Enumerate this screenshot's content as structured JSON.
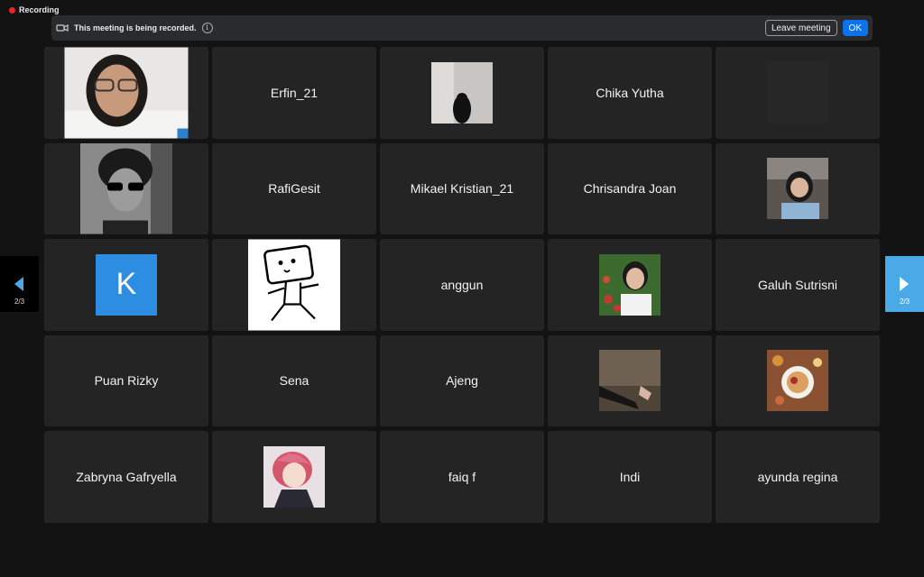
{
  "recording": {
    "label": "Recording"
  },
  "banner": {
    "text": "This meeting is being recorded.",
    "leave_label": "Leave meeting",
    "ok_label": "OK"
  },
  "participants": [
    {
      "name": "Erfin_21"
    },
    {
      "name": "Chika Yutha"
    },
    {
      "name": "RafiGesit"
    },
    {
      "name": "Mikael Kristian_21"
    },
    {
      "name": "Chrisandra Joan"
    },
    {
      "name": "anggun"
    },
    {
      "name": "Galuh Sutrisni"
    },
    {
      "name": "Puan Rizky"
    },
    {
      "name": "Sena"
    },
    {
      "name": "Ajeng"
    },
    {
      "name": "Zabryna Gafryella"
    },
    {
      "name": "faiq f"
    },
    {
      "name": "Indi"
    },
    {
      "name": "ayunda regina"
    }
  ],
  "avatar_initial": "K",
  "pagination": {
    "prev_label": "2/3",
    "next_label": "2/3"
  },
  "colors": {
    "background": "#131313",
    "tile": "#242424",
    "accent": "#0e72ed",
    "record": "#e8262a",
    "nav_next": "#4aaae8"
  }
}
